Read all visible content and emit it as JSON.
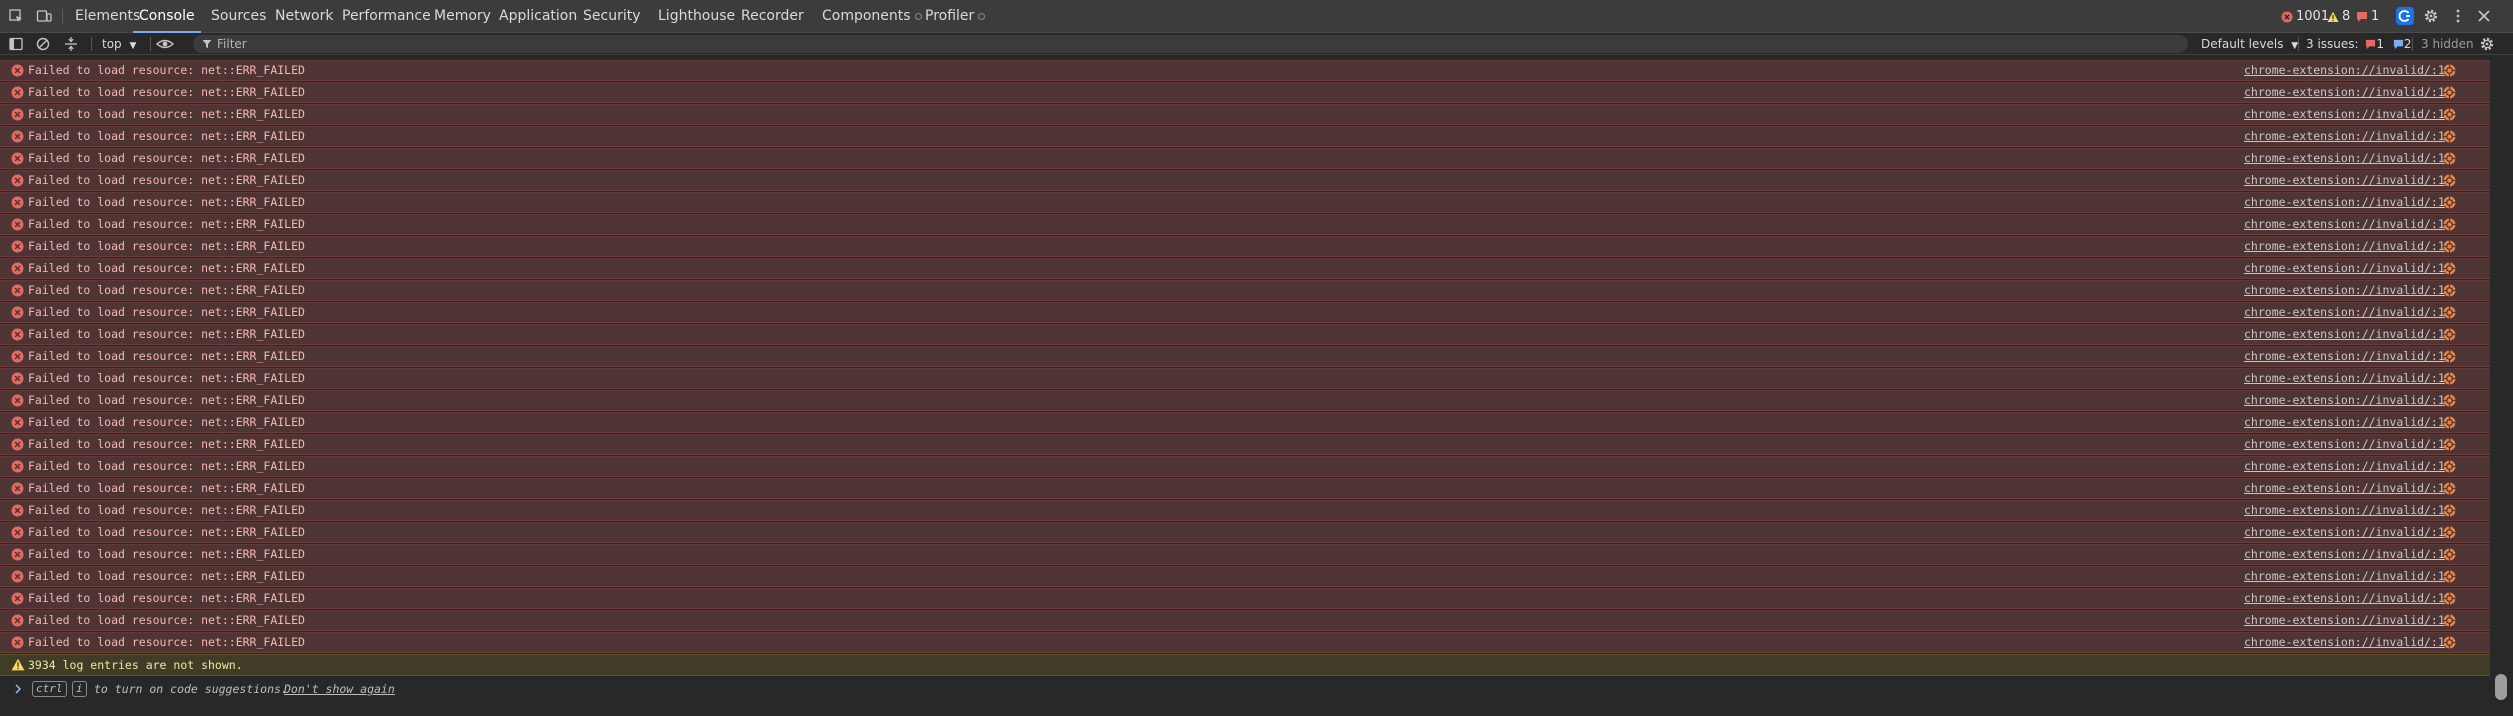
{
  "tabs": [
    {
      "label": "Elements"
    },
    {
      "label": "Console"
    },
    {
      "label": "Sources"
    },
    {
      "label": "Network"
    },
    {
      "label": "Performance"
    },
    {
      "label": "Memory"
    },
    {
      "label": "Application"
    },
    {
      "label": "Security"
    },
    {
      "label": "Lighthouse"
    },
    {
      "label": "Recorder"
    },
    {
      "label": "Components"
    },
    {
      "label": "Profiler"
    }
  ],
  "active_tab": "Console",
  "counters": {
    "errors": "1001",
    "warnings": "8",
    "issues": "1"
  },
  "toolbar": {
    "context": "top",
    "filter_placeholder": "Filter",
    "levels": "Default levels",
    "issues_label": "3 issues:",
    "issues_errors": "1",
    "issues_info": "2",
    "hidden": "3 hidden"
  },
  "messages": [
    {
      "text": "Failed to load resource: net::ERR_FAILED",
      "source": "chrome-extension://invalid/:1"
    },
    {
      "text": "Failed to load resource: net::ERR_FAILED",
      "source": "chrome-extension://invalid/:1"
    },
    {
      "text": "Failed to load resource: net::ERR_FAILED",
      "source": "chrome-extension://invalid/:1"
    },
    {
      "text": "Failed to load resource: net::ERR_FAILED",
      "source": "chrome-extension://invalid/:1"
    },
    {
      "text": "Failed to load resource: net::ERR_FAILED",
      "source": "chrome-extension://invalid/:1"
    },
    {
      "text": "Failed to load resource: net::ERR_FAILED",
      "source": "chrome-extension://invalid/:1"
    },
    {
      "text": "Failed to load resource: net::ERR_FAILED",
      "source": "chrome-extension://invalid/:1"
    },
    {
      "text": "Failed to load resource: net::ERR_FAILED",
      "source": "chrome-extension://invalid/:1"
    },
    {
      "text": "Failed to load resource: net::ERR_FAILED",
      "source": "chrome-extension://invalid/:1"
    },
    {
      "text": "Failed to load resource: net::ERR_FAILED",
      "source": "chrome-extension://invalid/:1"
    },
    {
      "text": "Failed to load resource: net::ERR_FAILED",
      "source": "chrome-extension://invalid/:1"
    },
    {
      "text": "Failed to load resource: net::ERR_FAILED",
      "source": "chrome-extension://invalid/:1"
    },
    {
      "text": "Failed to load resource: net::ERR_FAILED",
      "source": "chrome-extension://invalid/:1"
    },
    {
      "text": "Failed to load resource: net::ERR_FAILED",
      "source": "chrome-extension://invalid/:1"
    },
    {
      "text": "Failed to load resource: net::ERR_FAILED",
      "source": "chrome-extension://invalid/:1"
    },
    {
      "text": "Failed to load resource: net::ERR_FAILED",
      "source": "chrome-extension://invalid/:1"
    },
    {
      "text": "Failed to load resource: net::ERR_FAILED",
      "source": "chrome-extension://invalid/:1"
    },
    {
      "text": "Failed to load resource: net::ERR_FAILED",
      "source": "chrome-extension://invalid/:1"
    },
    {
      "text": "Failed to load resource: net::ERR_FAILED",
      "source": "chrome-extension://invalid/:1"
    },
    {
      "text": "Failed to load resource: net::ERR_FAILED",
      "source": "chrome-extension://invalid/:1"
    },
    {
      "text": "Failed to load resource: net::ERR_FAILED",
      "source": "chrome-extension://invalid/:1"
    },
    {
      "text": "Failed to load resource: net::ERR_FAILED",
      "source": "chrome-extension://invalid/:1"
    },
    {
      "text": "Failed to load resource: net::ERR_FAILED",
      "source": "chrome-extension://invalid/:1"
    },
    {
      "text": "Failed to load resource: net::ERR_FAILED",
      "source": "chrome-extension://invalid/:1"
    },
    {
      "text": "Failed to load resource: net::ERR_FAILED",
      "source": "chrome-extension://invalid/:1"
    },
    {
      "text": "Failed to load resource: net::ERR_FAILED",
      "source": "chrome-extension://invalid/:1"
    },
    {
      "text": "Failed to load resource: net::ERR_FAILED",
      "source": "chrome-extension://invalid/:1"
    }
  ],
  "warning": "3934 log entries are not shown.",
  "prompt": {
    "key1": "ctrl",
    "key2": "i",
    "hint": "to turn on code suggestions.",
    "dismiss": "Don't show again"
  },
  "colors": {
    "error": "#e46962",
    "warning": "#fdd663",
    "accent": "#7cacf8",
    "error_row_bg": "#4e3534",
    "warning_row_bg": "#413c26"
  },
  "icons": {
    "error_row": "error-circle-icon",
    "warning_row": "warning-triangle-icon",
    "source_row": "extension-icon"
  }
}
